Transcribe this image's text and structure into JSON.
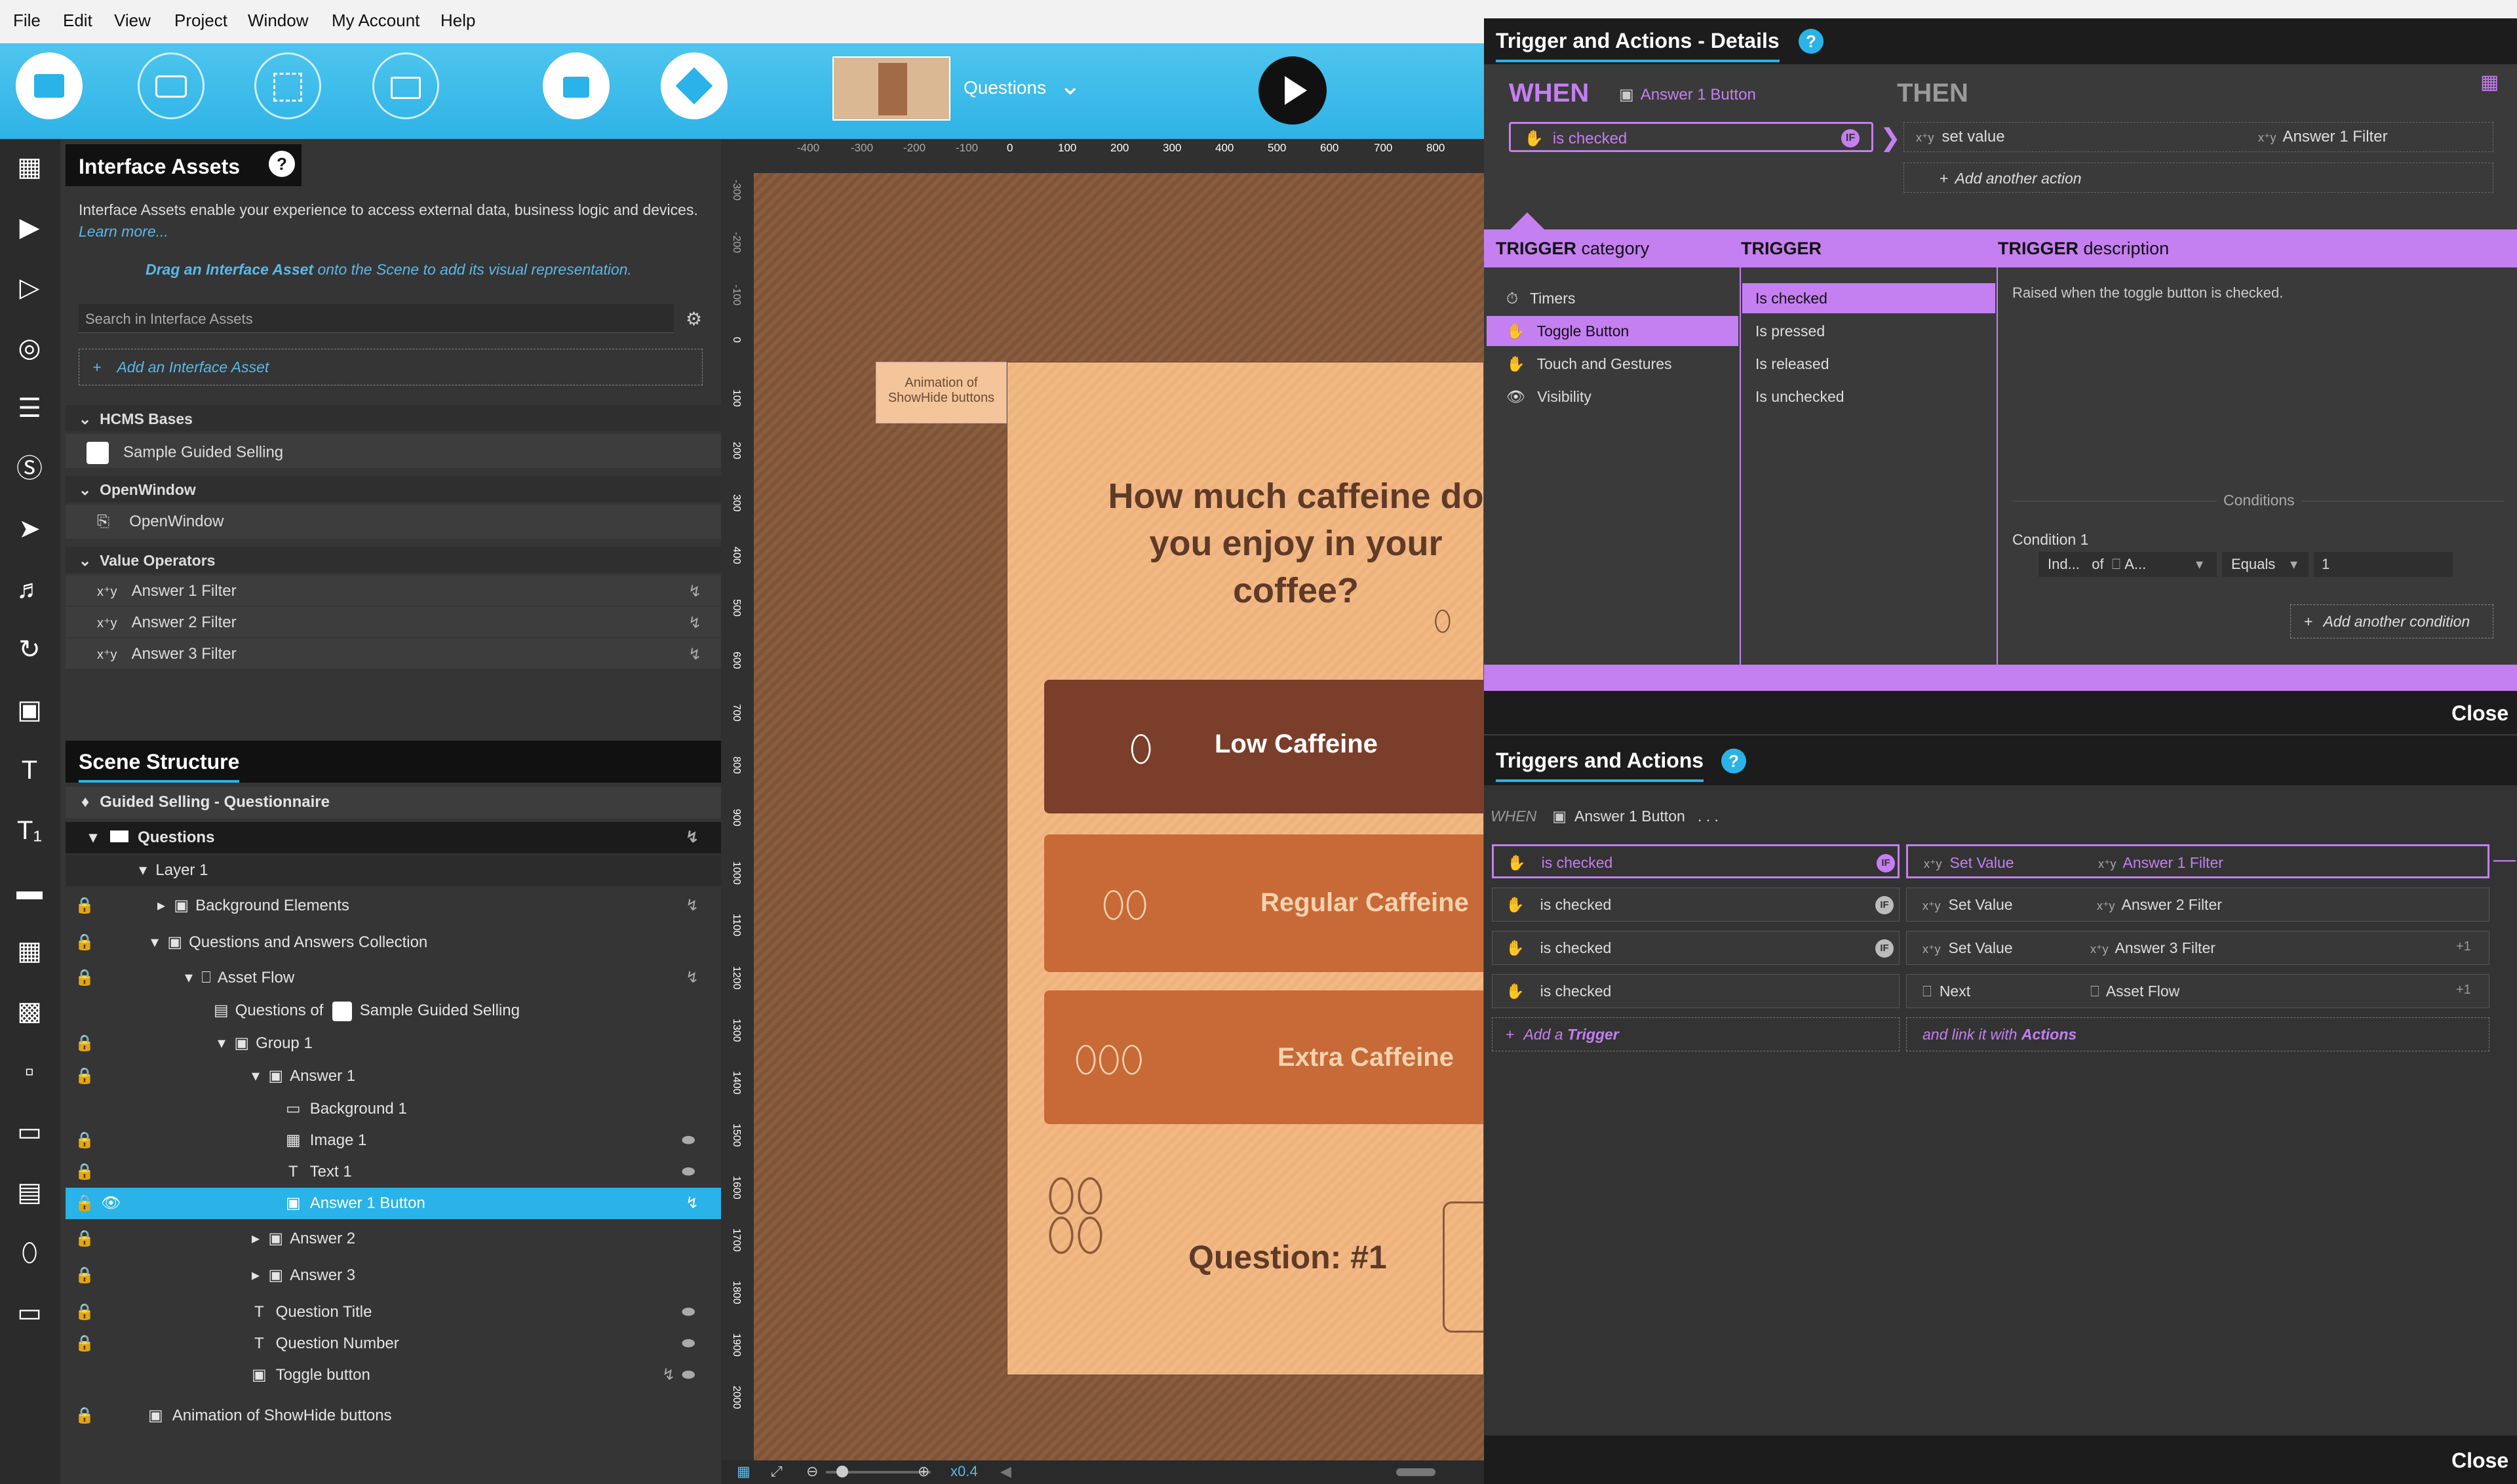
{
  "menu": [
    "File",
    "Edit",
    "View",
    "Project",
    "Window",
    "My Account",
    "Help"
  ],
  "toolbar": {
    "scene_name": "Questions"
  },
  "interface_assets": {
    "title": "Interface Assets",
    "help": "?",
    "intro": "Interface Assets enable your experience to access external data, business logic and devices.",
    "learn_more": "Learn more...",
    "drag_hint_bold": "Drag an Interface Asset",
    "drag_hint_rest": " onto the Scene to add its visual representation.",
    "search_placeholder": "Search in Interface Assets",
    "add_label": "Add an Interface Asset",
    "sections": [
      {
        "name": "HCMS Bases",
        "items": [
          "Sample Guided Selling"
        ]
      },
      {
        "name": "OpenWindow",
        "items": [
          "OpenWindow"
        ]
      },
      {
        "name": "Value Operators",
        "items": [
          "Answer 1 Filter",
          "Answer 2 Filter",
          "Answer 3 Filter"
        ]
      }
    ]
  },
  "scene_structure": {
    "title": "Scene Structure",
    "root": "Guided Selling - Questionnaire",
    "nodes": [
      "Questions",
      "Layer 1",
      "Background Elements",
      "Questions and Answers Collection",
      "Asset Flow",
      "Questions of",
      "Sample Guided Selling",
      "Group 1",
      "Answer 1",
      "Background 1",
      "Image 1",
      "Text 1",
      "Answer 1 Button",
      "Answer 2",
      "Answer 3",
      "Question Title",
      "Question Number",
      "Toggle button",
      "Animation of ShowHide buttons"
    ]
  },
  "ruler": {
    "h": [
      "-400",
      "-300",
      "-200",
      "-100",
      "0",
      "100",
      "200",
      "300",
      "400",
      "500",
      "600",
      "700",
      "800"
    ],
    "v": [
      "-300",
      "-200",
      "-100",
      "0",
      "100",
      "200",
      "300",
      "400",
      "500",
      "600",
      "700",
      "800",
      "900",
      "1000",
      "1100",
      "1200",
      "1300",
      "1400",
      "1500",
      "1600",
      "1700",
      "1800",
      "1900",
      "2000"
    ]
  },
  "stage": {
    "anim_label": "Animation of ShowHide buttons",
    "question": "How much caffeine do you enjoy in your coffee?",
    "answers": [
      "Low Caffeine",
      "Regular Caffeine",
      "Extra Caffeine"
    ],
    "qnum": "Question: #1",
    "zoom": "x0.4"
  },
  "details": {
    "title": "Trigger and Actions - Details",
    "help": "?",
    "when": "WHEN",
    "then": "THEN",
    "when_target": "Answer 1 Button",
    "when_trigger": "is checked",
    "then_action": "set value",
    "then_target": "Answer 1 Filter",
    "add_action": "Add another action",
    "cat_hdr": "TRIGGER",
    "cat_sub": "category",
    "trig_hdr": "TRIGGER",
    "desc_hdr": "TRIGGER",
    "desc_sub": "description",
    "categories": [
      "Timers",
      "Toggle Button",
      "Touch and Gestures",
      "Visibility"
    ],
    "triggers": [
      "Is checked",
      "Is pressed",
      "Is released",
      "Is unchecked"
    ],
    "description": "Raised when the toggle button is checked.",
    "conditions_label": "Conditions",
    "condition1": "Condition 1",
    "cond_field": "Ind...",
    "cond_of": "of",
    "cond_obj": "A...",
    "cond_op": "Equals",
    "cond_val": "1",
    "add_condition": "Add another condition",
    "close": "Close"
  },
  "ta": {
    "title": "Triggers and Actions",
    "help": "?",
    "when": "WHEN",
    "when_target": "Answer 1 Button",
    "dots": ". . .",
    "rows": [
      {
        "trigger": "is checked",
        "action": "Set Value",
        "target": "Answer 1 Filter",
        "extra": ""
      },
      {
        "trigger": "is checked",
        "action": "Set Value",
        "target": "Answer 2 Filter",
        "extra": ""
      },
      {
        "trigger": "is checked",
        "action": "Set Value",
        "target": "Answer 3 Filter",
        "extra": "+1"
      },
      {
        "trigger": "is checked",
        "action": "Next",
        "target": "Asset Flow",
        "extra": "+1"
      }
    ],
    "add_trigger_a": "Add a ",
    "add_trigger_b": "Trigger",
    "link_a": "and link it with ",
    "link_b": "Actions",
    "close": "Close"
  },
  "colors": {
    "accent": "#c47ff1",
    "blue": "#29b3e8",
    "toolbar": "#3dbce9"
  }
}
